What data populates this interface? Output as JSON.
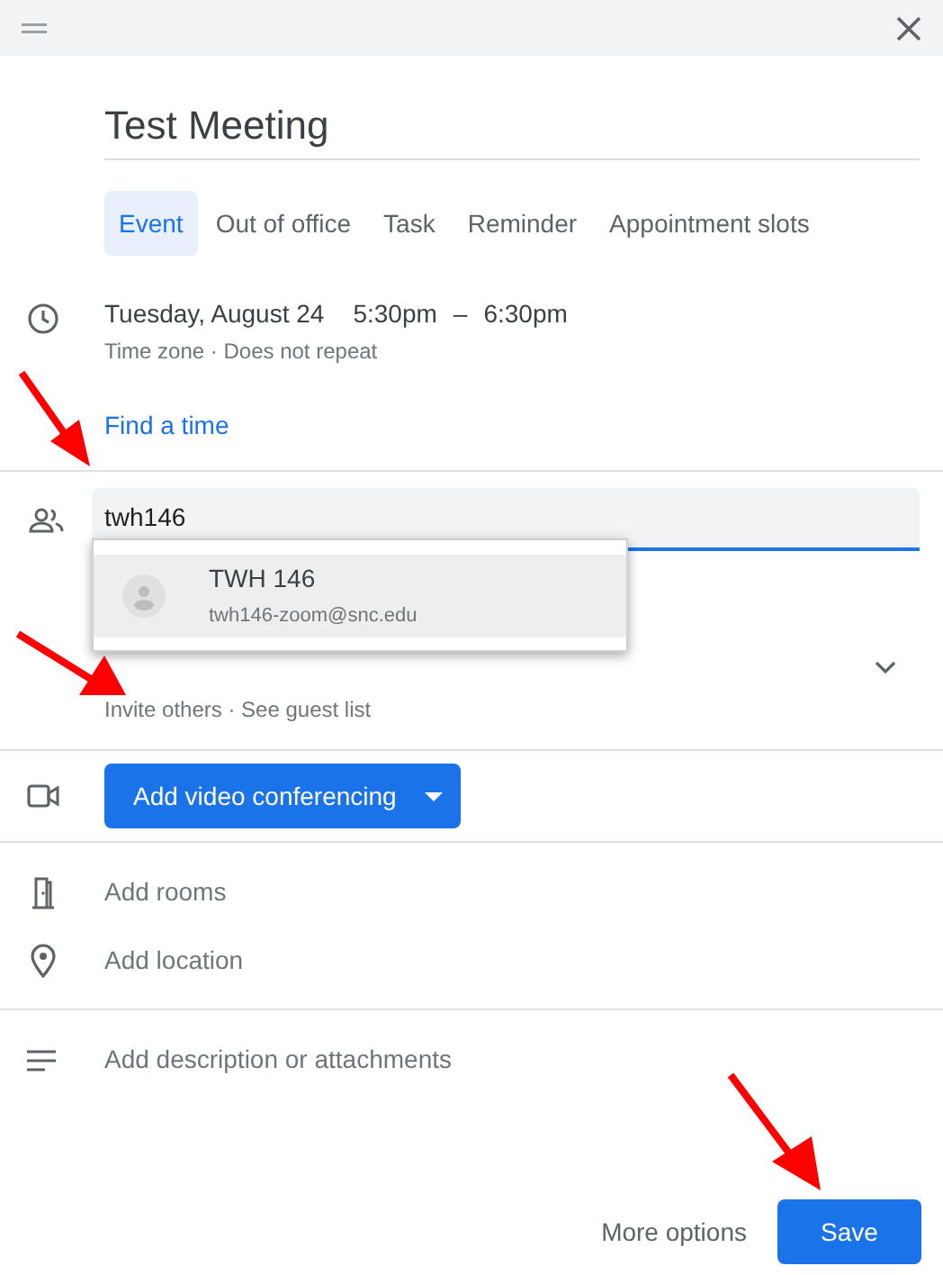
{
  "title": "Test Meeting",
  "tabs": [
    {
      "label": "Event",
      "selected": true
    },
    {
      "label": "Out of office",
      "selected": false
    },
    {
      "label": "Task",
      "selected": false
    },
    {
      "label": "Reminder",
      "selected": false
    },
    {
      "label": "Appointment slots",
      "selected": false
    }
  ],
  "date": "Tuesday, August 24",
  "start": "5:30pm",
  "dash": "–",
  "end": "6:30pm",
  "time_details": "Time zone · Does not repeat",
  "find_time": "Find a time",
  "guest_field": {
    "value": "twh146"
  },
  "suggestion": {
    "name": "TWH 146",
    "email": "twh146-zoom@snc.edu"
  },
  "guest_details": "Invite others · See guest list",
  "video_button": "Add video conferencing",
  "rooms": "Add rooms",
  "location": "Add location",
  "description": "Add description or attachments",
  "more_options": "More options",
  "save": "Save"
}
